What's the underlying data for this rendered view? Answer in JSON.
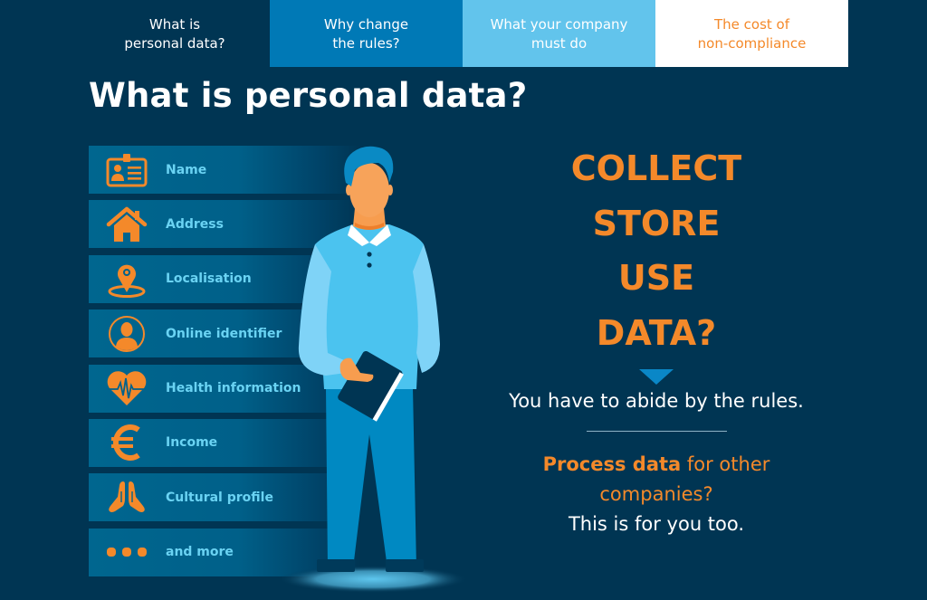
{
  "tabs": [
    {
      "label": "What is\npersonal data?",
      "active": true
    },
    {
      "label": "Why change\nthe rules?"
    },
    {
      "label": "What your company\nmust do"
    },
    {
      "label": "The cost of\nnon-compliance"
    }
  ],
  "page_title": "What is personal data?",
  "data_types": [
    {
      "label": "Name",
      "icon": "id-badge-icon"
    },
    {
      "label": "Address",
      "icon": "house-icon"
    },
    {
      "label": "Localisation",
      "icon": "location-pin-icon"
    },
    {
      "label": "Online identifier",
      "icon": "user-profile-icon"
    },
    {
      "label": "Health information",
      "icon": "heart-pulse-icon"
    },
    {
      "label": "Income",
      "icon": "euro-icon"
    },
    {
      "label": "Cultural profile",
      "icon": "praying-hands-icon"
    },
    {
      "label": "and more",
      "icon": "ellipsis-icon"
    }
  ],
  "callout": {
    "lines": [
      "COLLECT",
      "STORE",
      "USE",
      "DATA?"
    ],
    "rule_text": "You have to abide by the rules.",
    "process_bold": "Process data",
    "process_rest": " for other companies?",
    "for_you": "This is for you too."
  },
  "colors": {
    "background": "#003553",
    "accent_orange": "#f4892a",
    "tab_blue": "#0079b6",
    "tab_light_blue": "#62c4ec",
    "label_cyan": "#6ad3f3"
  }
}
